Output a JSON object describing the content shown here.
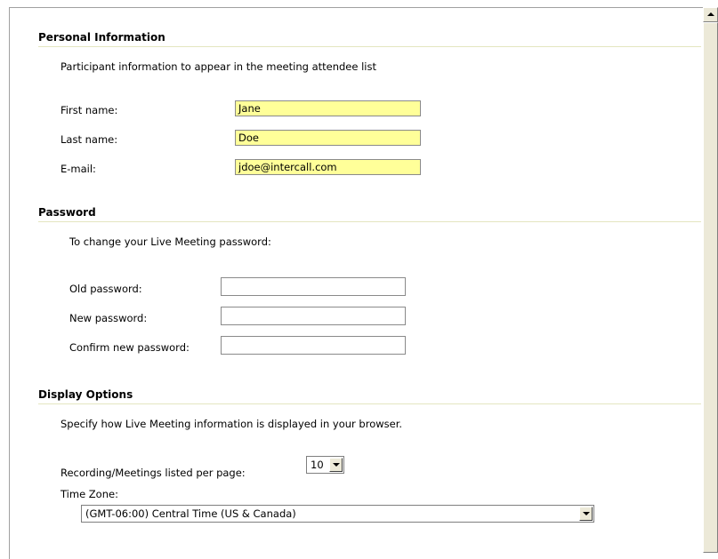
{
  "personal": {
    "title": "Personal Information",
    "description": "Participant information to appear in the meeting attendee list",
    "first_name_label": "First name:",
    "first_name_value": "Jane",
    "last_name_label": "Last name:",
    "last_name_value": "Doe",
    "email_label": "E-mail:",
    "email_value": "jdoe@intercall.com"
  },
  "password": {
    "title": "Password",
    "description": "To change your Live Meeting password:",
    "old_label": "Old password:",
    "new_label": "New password:",
    "confirm_label": "Confirm new password:",
    "old_value": "",
    "new_value": "",
    "confirm_value": ""
  },
  "display": {
    "title": "Display Options",
    "description": "Specify how Live Meeting information is displayed in your browser.",
    "per_page_label": "Recording/Meetings listed per page:",
    "per_page_value": "10",
    "timezone_label": "Time Zone:",
    "timezone_value": "(GMT-06:00) Central Time (US & Canada)"
  },
  "colors": {
    "filled_field_bg": "#ffff99",
    "section_rule": "#e4e6c0"
  }
}
